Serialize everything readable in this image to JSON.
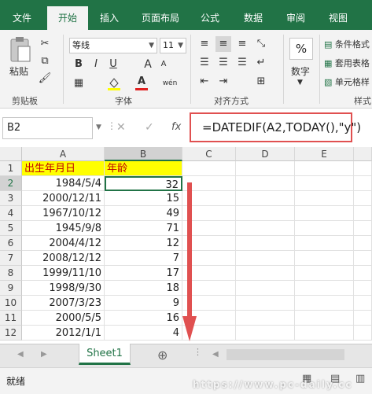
{
  "ribbon_tabs": [
    "文件",
    "开始",
    "插入",
    "页面布局",
    "公式",
    "数据",
    "审阅",
    "视图"
  ],
  "active_tab": "开始",
  "clipboard": {
    "paste_label": "粘贴",
    "group_label": "剪贴板"
  },
  "font": {
    "name": "等线",
    "size": "11",
    "group_label": "字体",
    "bold": "B",
    "italic": "I",
    "underline": "U",
    "grow": "A",
    "shrink": "A",
    "color_letter": "A",
    "phonetic": "wén"
  },
  "alignment": {
    "group_label": "对齐方式"
  },
  "number": {
    "percent": "%",
    "label": "数字"
  },
  "styles": {
    "conditional": "条件格式",
    "table": "套用表格",
    "cell": "单元格样",
    "group_label": "样式"
  },
  "formula_bar": {
    "name_box": "B2",
    "fx": "fx",
    "cancel": "✕",
    "confirm": "✓",
    "formula": "=DATEDIF(A2,TODAY(),\"y\")"
  },
  "columns": [
    "A",
    "B",
    "C",
    "D",
    "E"
  ],
  "rows": [
    {
      "n": "1",
      "a": "出生年月日",
      "b": "年龄"
    },
    {
      "n": "2",
      "a": "1984/5/4",
      "b": "32"
    },
    {
      "n": "3",
      "a": "2000/12/11",
      "b": "15"
    },
    {
      "n": "4",
      "a": "1967/10/12",
      "b": "49"
    },
    {
      "n": "5",
      "a": "1945/9/8",
      "b": "71"
    },
    {
      "n": "6",
      "a": "2004/4/12",
      "b": "12"
    },
    {
      "n": "7",
      "a": "2008/12/12",
      "b": "7"
    },
    {
      "n": "8",
      "a": "1999/11/10",
      "b": "17"
    },
    {
      "n": "9",
      "a": "1998/9/30",
      "b": "18"
    },
    {
      "n": "10",
      "a": "2007/3/23",
      "b": "9"
    },
    {
      "n": "11",
      "a": "2000/5/5",
      "b": "16"
    },
    {
      "n": "12",
      "a": "2012/1/1",
      "b": "4"
    }
  ],
  "sheet_tab": "Sheet1",
  "add_sheet": "⊕",
  "status": "就绪",
  "watermark": "https://www.pc-daily.cc",
  "colors": {
    "excel_green": "#217346",
    "header_yellow": "#ffff00",
    "header_red": "#c00000",
    "annotation_red": "#e05050"
  }
}
